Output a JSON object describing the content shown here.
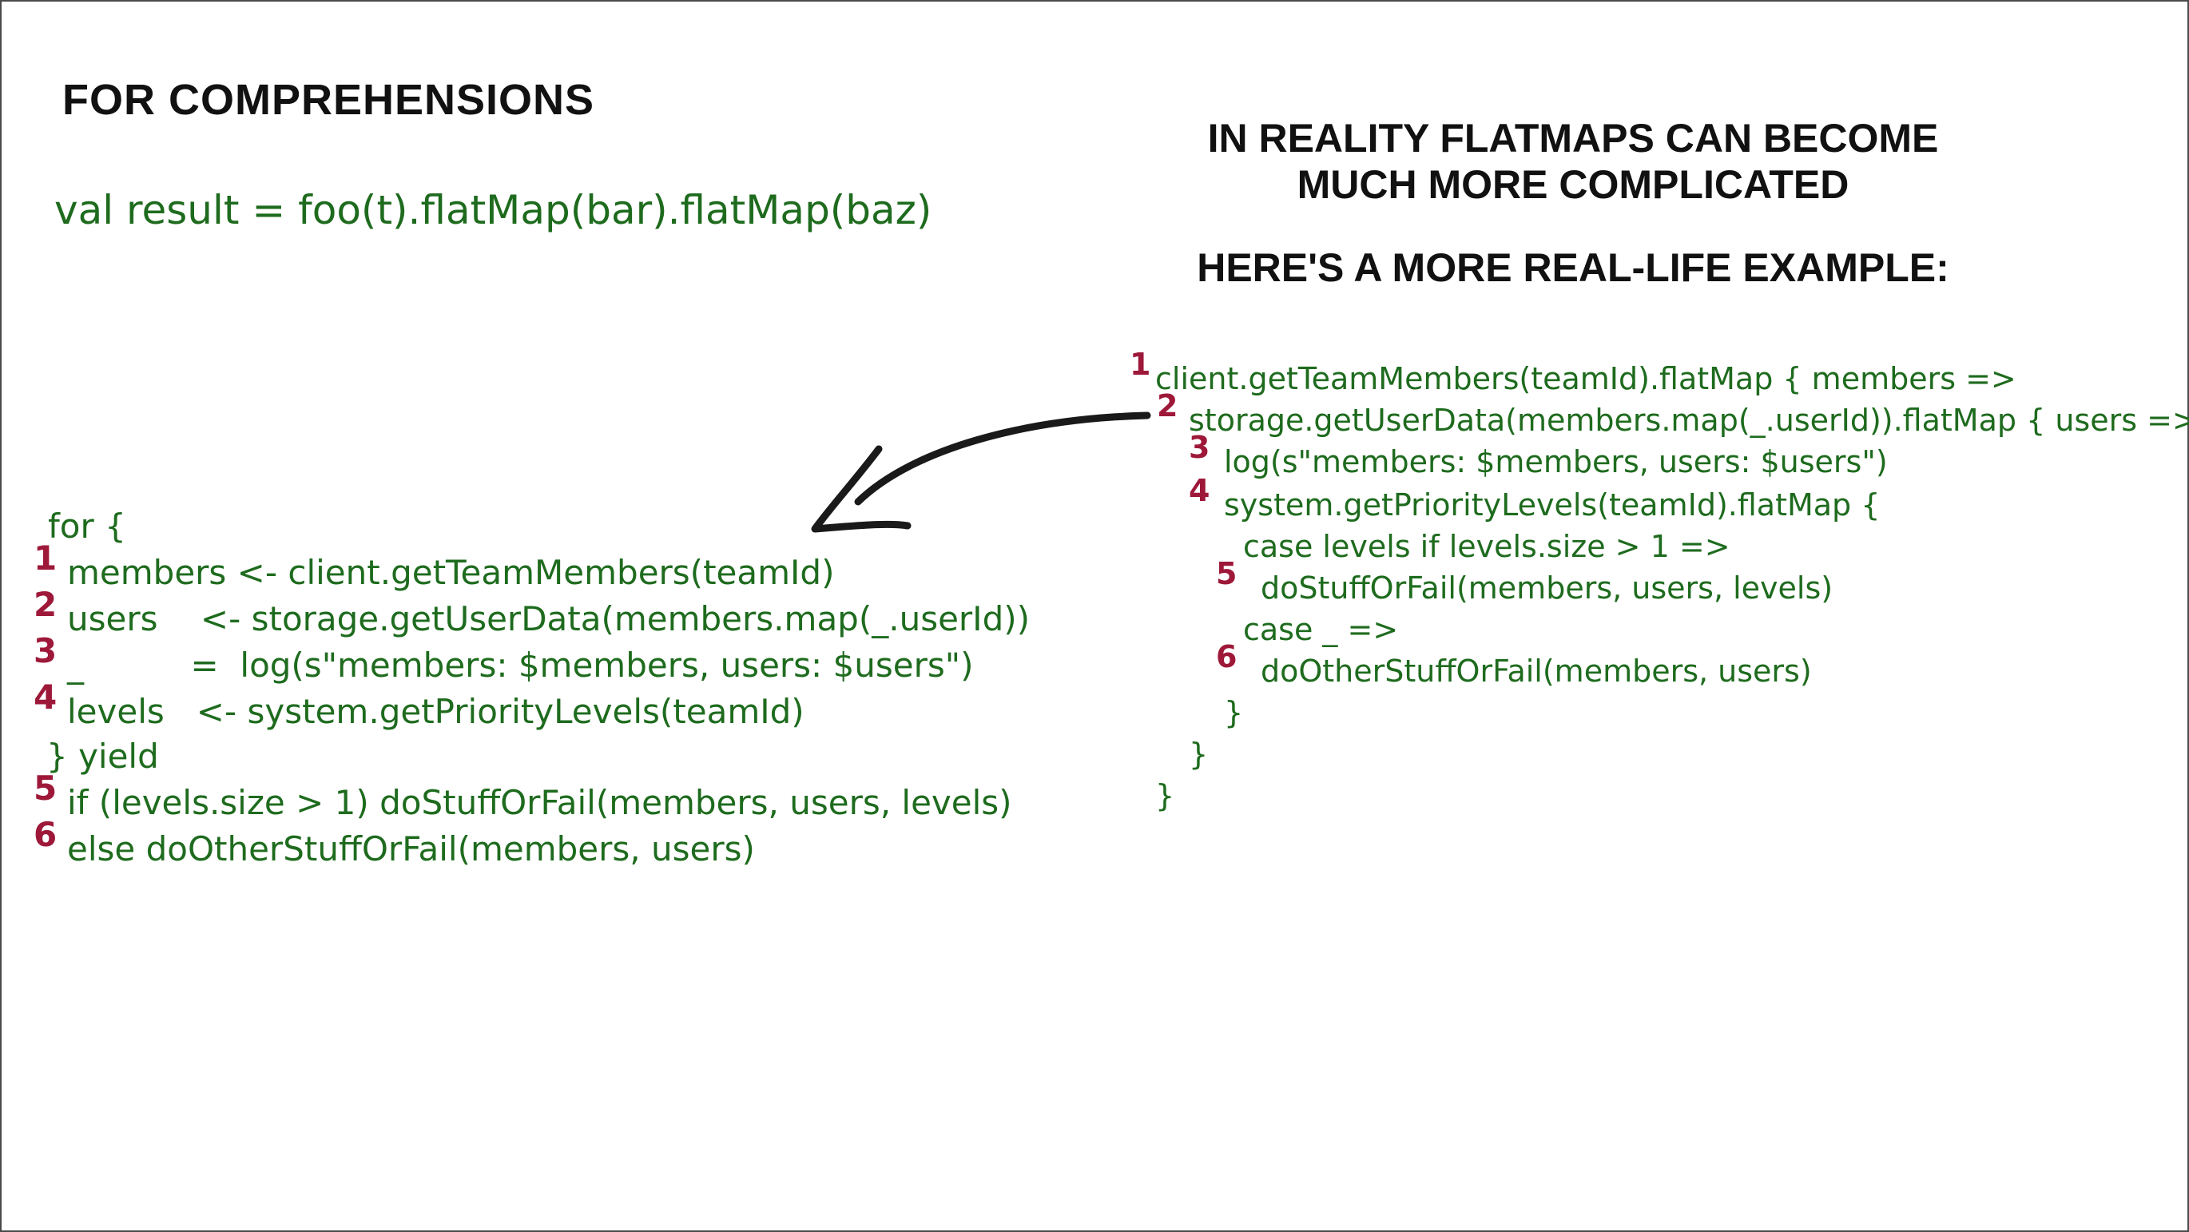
{
  "headings": {
    "left": "FOR COMPREHENSIONS",
    "right_line1": "IN REALITY FLATMAPS CAN BECOME",
    "right_line2": "MUCH MORE COMPLICATED",
    "right_subtitle": "HERE'S A MORE REAL-LIFE EXAMPLE:"
  },
  "one_liner": "val result = foo(t).flatMap(bar).flatMap(baz)",
  "for_block": [
    {
      "num": "",
      "text": "for {"
    },
    {
      "num": "1",
      "text": "members <- client.getTeamMembers(teamId)"
    },
    {
      "num": "2",
      "text": "users    <- storage.getUserData(members.map(_.userId))"
    },
    {
      "num": "3",
      "text": "_          =  log(s\"members: $members, users: $users\")"
    },
    {
      "num": "4",
      "text": "levels   <- system.getPriorityLevels(teamId)"
    },
    {
      "num": "",
      "text": "} yield"
    },
    {
      "num": "5",
      "text": "if (levels.size > 1) doStuffOrFail(members, users, levels)"
    },
    {
      "num": "6",
      "text": "else doOtherStuffOrFail(members, users)"
    }
  ],
  "flatmap_block": [
    {
      "num": "1",
      "text": "client.getTeamMembers(teamId).flatMap { members =>"
    },
    {
      "num": "2",
      "text": "storage.getUserData(members.map(_.userId)).flatMap { users =>"
    },
    {
      "num": "3",
      "text": "log(s\"members: $members, users: $users\")"
    },
    {
      "num": "4",
      "text": "system.getPriorityLevels(teamId).flatMap {"
    },
    {
      "num": "",
      "text": "case levels if levels.size > 1 =>"
    },
    {
      "num": "5",
      "text": "doStuffOrFail(members, users, levels)"
    },
    {
      "num": "",
      "text": "case _ =>"
    },
    {
      "num": "6",
      "text": "doOtherStuffOrFail(members, users)"
    },
    {
      "num": "",
      "text": "}"
    },
    {
      "num": "",
      "text": "}"
    },
    {
      "num": "",
      "text": "}"
    }
  ],
  "colors": {
    "code": "#1e6b1e",
    "line_numbers": "#9e1839",
    "headings": "#111111",
    "arrow": "#1a1a1a"
  }
}
